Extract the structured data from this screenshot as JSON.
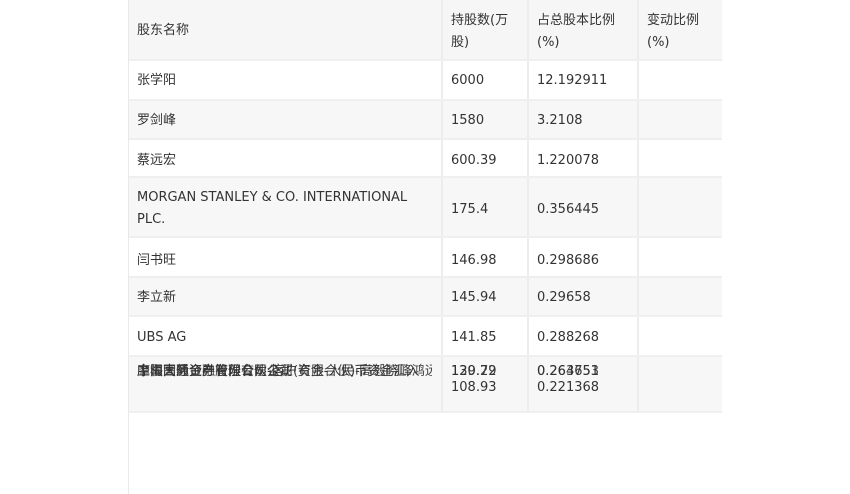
{
  "table": {
    "headers": {
      "name": "股东名称",
      "shares": "持股数(万股)",
      "pct": "占总股本比例(%)",
      "change": "变动比例(%)"
    },
    "rows": [
      {
        "name": "张学阳",
        "shares": "6000",
        "pct": "12.192911",
        "change": ""
      },
      {
        "name": "罗剑峰",
        "shares": "1580",
        "pct": "3.2108",
        "change": ""
      },
      {
        "name": "蔡远宏",
        "shares": "600.39",
        "pct": "1.220078",
        "change": ""
      },
      {
        "name": "MORGAN STANLEY & CO. INTERNATIONAL PLC.",
        "shares": "175.4",
        "pct": "0.356445",
        "change": ""
      },
      {
        "name": "闫书旺",
        "shares": "146.98",
        "pct": "0.298686",
        "change": ""
      },
      {
        "name": "李立新",
        "shares": "145.94",
        "pct": "0.29658",
        "change": ""
      },
      {
        "name": "UBS AG",
        "shares": "141.85",
        "pct": "0.288268",
        "change": ""
      },
      {
        "name": "上海高毅资产管理合伙企业(有限合伙)-高毅晓峰鸿远集合资金信托计划",
        "shares": "130.22",
        "pct": "0.264651",
        "change": ""
      },
      {
        "name": "中国国际金融股份有限公司",
        "shares": "129.79",
        "pct": "0.263753",
        "change": ""
      },
      {
        "name": "摩根大通证券有限公司-客户资金-人民币资金汇入",
        "shares": "108.93",
        "pct": "0.221368",
        "change": ""
      }
    ]
  }
}
